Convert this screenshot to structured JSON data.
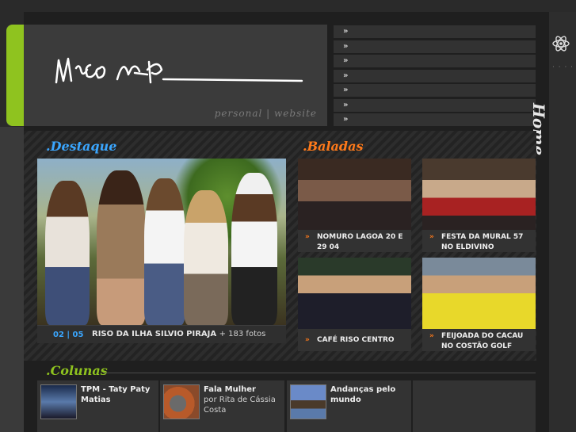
{
  "header": {
    "tagline": "personal | website"
  },
  "nav": {
    "items": [
      "»",
      "»",
      "»",
      "»",
      "»",
      "»",
      "»"
    ]
  },
  "sidebar": {
    "home_label": "Home"
  },
  "destaque": {
    "title": ".Destaque",
    "pager": "02 | 05",
    "caption": "RISO DA ILHA SILVIO PIRAJA",
    "more": "+ 183 fotos"
  },
  "baladas": {
    "title": ".Baladas",
    "items": [
      {
        "label": "NOMURO LAGOA 20 E 29 04"
      },
      {
        "label": "FESTA DA MURAL 57 NO ELDIVINO"
      },
      {
        "label": "CAFÉ RISO CENTRO"
      },
      {
        "label": "FEIJOADA DO CACAU NO COSTÃO GOLF"
      }
    ]
  },
  "colunas": {
    "title": ".Colunas",
    "items": [
      {
        "title": "TPM - Taty Paty Matias",
        "subtitle": ""
      },
      {
        "title": "Fala Mulher",
        "subtitle": "por Rita de Cássia Costa"
      },
      {
        "title": "Andanças pelo mundo",
        "subtitle": ""
      }
    ]
  },
  "colors": {
    "accent_green": "#8fc31f",
    "accent_blue": "#3aa6ff",
    "accent_orange": "#ff7a1a",
    "background": "#2a2a2a"
  }
}
